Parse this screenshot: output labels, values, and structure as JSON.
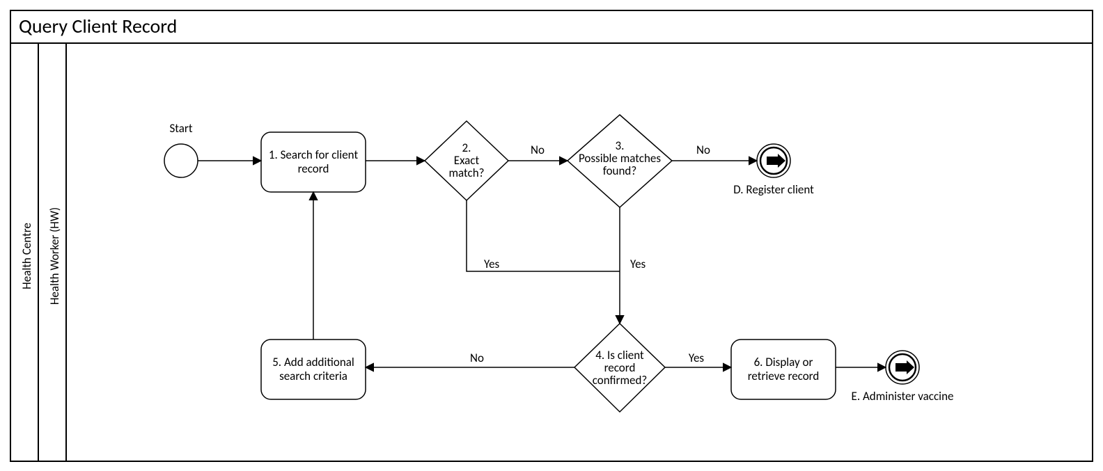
{
  "diagram": {
    "title": "Query Client Record",
    "pool_label": "Health Centre",
    "lane_label": "Health Worker (HW)",
    "start_label": "Start",
    "tasks": {
      "t1": "1. Search for client record",
      "t5": "5. Add additional search criteria",
      "t6": "6. Display or retrieve record"
    },
    "gateways": {
      "g2_l1": "2.",
      "g2_l2": "Exact",
      "g2_l3": "match?",
      "g3_l1": "3.",
      "g3_l2": "Possible matches",
      "g3_l3": "found?",
      "g4_l1": "4. Is client",
      "g4_l2": "record",
      "g4_l3": "confirmed?"
    },
    "ends": {
      "eD": "D. Register client",
      "eE": "E. Administer vaccine"
    },
    "edge_labels": {
      "g2_no": "No",
      "g2_yes": "Yes",
      "g3_no": "No",
      "g3_yes": "Yes",
      "g4_no": "No",
      "g4_yes": "Yes"
    }
  }
}
